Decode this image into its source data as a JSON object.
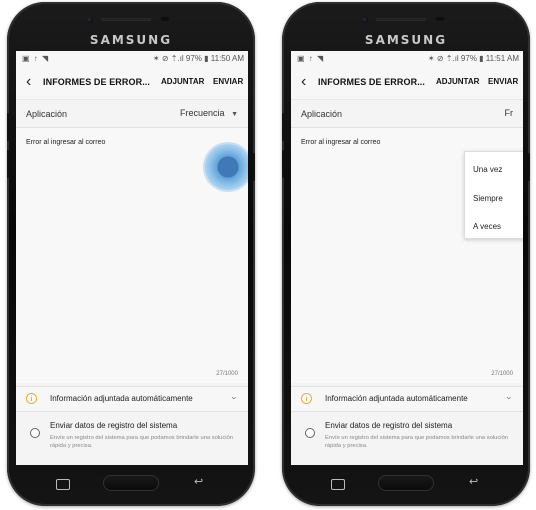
{
  "brand": "SAMSUNG",
  "screens": [
    {
      "status": {
        "left_icons": "▣ ↑ ◥",
        "right_info": "✶ ⊘ ⇡.ıl 97% ▮ 11:50 AM"
      },
      "app_bar": {
        "back_icon": "back-arrow-icon",
        "title": "INFORMES DE ERROR...",
        "attach_label": "ADJUNTAR",
        "send_label": "ENVIAR"
      },
      "field": {
        "label": "Aplicación",
        "value": "Frecuencia"
      },
      "text_content": "Error al ingresar al correo",
      "counter": "27/1000",
      "info_label": "Información adjuntada automáticamente",
      "option": {
        "title": "Enviar datos de registro del sistema",
        "description": "Envíe un registro del sistema para que podamos brindarle una solución rápida y precisa."
      }
    },
    {
      "status": {
        "left_icons": "▣ ↑ ◥",
        "right_info": "✶ ⊘ ⇡.ıl 97% ▮ 11:51 AM"
      },
      "app_bar": {
        "back_icon": "back-arrow-icon",
        "title": "INFORMES DE ERROR...",
        "attach_label": "ADJUNTAR",
        "send_label": "ENVIAR"
      },
      "field": {
        "label": "Aplicación",
        "value": "Fr"
      },
      "text_content": "Error al ingresar al correo",
      "counter": "27/1000",
      "info_label": "Información adjuntada automáticamente",
      "option": {
        "title": "Enviar datos de registro del sistema",
        "description": "Envíe un registro del sistema para que podamos brindarle una solución rápida y precisa."
      },
      "popup_options": [
        "Una vez",
        "Siempre",
        "A veces"
      ]
    }
  ],
  "colors": {
    "touch": "#4795d3",
    "info_icon": "#f2a72c"
  }
}
